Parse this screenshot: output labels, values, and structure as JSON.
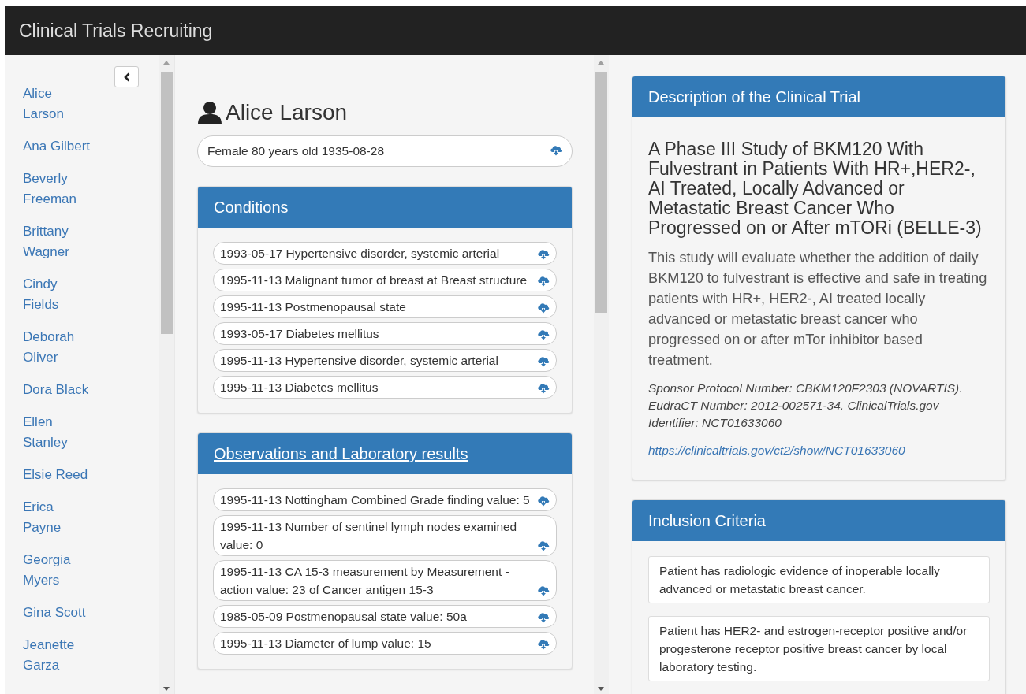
{
  "navbar": {
    "title": "Clinical Trials Recruiting"
  },
  "sidebar": {
    "patients": [
      {
        "name": "Alice Larson"
      },
      {
        "name": "Ana Gilbert"
      },
      {
        "name": "Beverly Freeman"
      },
      {
        "name": "Brittany Wagner"
      },
      {
        "name": "Cindy Fields"
      },
      {
        "name": "Deborah Oliver"
      },
      {
        "name": "Dora Black"
      },
      {
        "name": "Ellen Stanley"
      },
      {
        "name": "Elsie Reed"
      },
      {
        "name": "Erica Payne"
      },
      {
        "name": "Georgia Myers"
      },
      {
        "name": "Gina Scott"
      },
      {
        "name": "Jeanette Garza"
      }
    ]
  },
  "patient": {
    "name": "Alice Larson",
    "demographics": "Female 80 years old 1935-08-28"
  },
  "panels": [
    {
      "title": "Conditions",
      "linked": false,
      "items": [
        "1993-05-17 Hypertensive disorder, systemic arterial",
        "1995-11-13 Malignant tumor of breast at Breast structure",
        "1995-11-13 Postmenopausal state",
        "1993-05-17 Diabetes mellitus",
        "1995-11-13 Hypertensive disorder, systemic arterial",
        "1995-11-13 Diabetes mellitus"
      ]
    },
    {
      "title": "Observations and Laboratory results",
      "linked": true,
      "items": [
        "1995-11-13 Nottingham Combined Grade finding value: 5",
        "1995-11-13 Number of sentinel lymph nodes examined value: 0",
        "1995-11-13 CA 15-3 measurement by Measurement - action value: 23 of Cancer antigen 15-3",
        "1985-05-09 Postmenopausal state value: 50a",
        "1995-11-13 Diameter of lump value: 15"
      ]
    }
  ],
  "trial": {
    "header": "Description of the Clinical Trial",
    "title": "A Phase III Study of BKM120 With Fulvestrant in Patients With HR+,HER2-, AI Treated, Locally Advanced or Metastatic Breast Cancer Who Progressed on or After mTORi (BELLE-3)",
    "summary": "This study will evaluate whether the addition of daily BKM120 to fulvestrant is effective and safe in treating patients with HR+, HER2-, AI treated locally advanced or metastatic breast cancer who progressed on or after mTor inhibitor based treatment.",
    "identifiers": "Sponsor Protocol Number: CBKM120F2303 (NOVARTIS). EudraCT Number: 2012-002571-34. ClinicalTrials.gov Identifier: NCT01633060",
    "url": "https://clinicaltrials.gov/ct2/show/NCT01633060"
  },
  "inclusion": {
    "header": "Inclusion Criteria",
    "criteria": [
      "Patient has radiologic evidence of inoperable locally advanced or metastatic breast cancer.",
      "Patient has HER2- and estrogen-receptor positive and/or progesterone receptor positive breast cancer by local laboratory testing."
    ]
  }
}
